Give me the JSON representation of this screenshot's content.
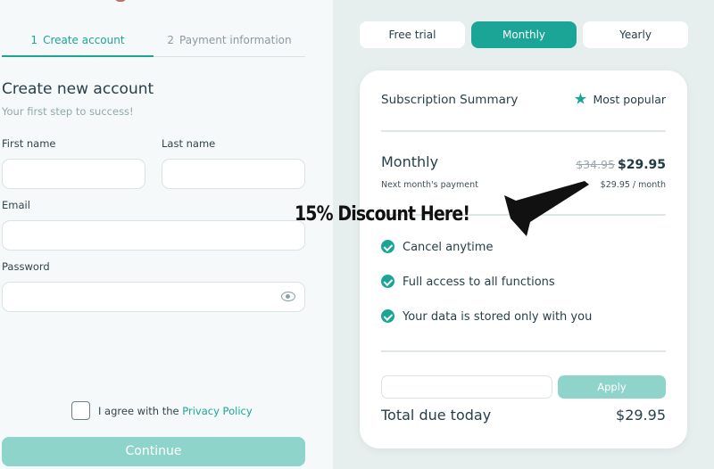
{
  "signup": {
    "steps": [
      {
        "num": "1",
        "label": "Create account"
      },
      {
        "num": "2",
        "label": "Payment information"
      }
    ],
    "title": "Create new account",
    "subtitle": "Your first step to success!",
    "fields": {
      "first_name_label": "First name",
      "last_name_label": "Last name",
      "email_label": "Email",
      "password_label": "Password"
    },
    "agree_prefix": "I agree with the ",
    "agree_link": "Privacy Policy",
    "continue_label": "Continue"
  },
  "plans": {
    "tabs": [
      "Free trial",
      "Monthly",
      "Yearly"
    ],
    "active_tab": "Monthly"
  },
  "summary": {
    "title": "Subscription Summary",
    "badge": "Most popular",
    "plan_name": "Monthly",
    "old_price": "$34.95",
    "new_price": "$29.95",
    "next_payment_label": "Next month's payment",
    "per_month": "$29.95 / month",
    "features": [
      "Cancel anytime",
      "Full access to all functions",
      "Your data is stored only with you"
    ],
    "apply_label": "Apply",
    "total_label": "Total due today",
    "total_value": "$29.95"
  },
  "annotation": {
    "text": "15% Discount Here!"
  },
  "colors": {
    "accent": "#1aa596",
    "accent_light": "#8fd4ca",
    "right_bg": "#e6efed"
  },
  "icons": {
    "eye": "eye-icon",
    "star": "star-icon",
    "check": "check-circle-icon",
    "arrow": "arrow-annotation"
  }
}
